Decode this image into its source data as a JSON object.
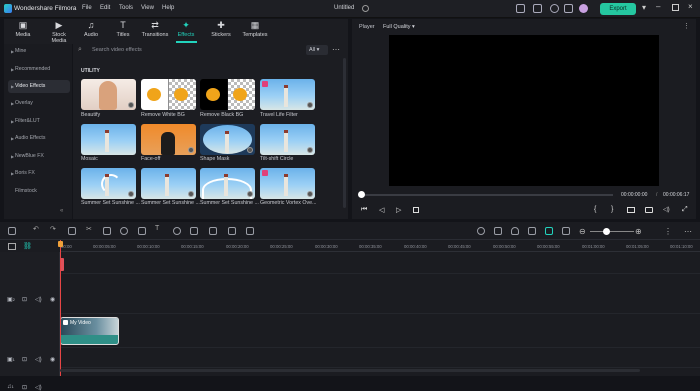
{
  "app": {
    "name": "Wondershare Filmora",
    "project": "Untitled",
    "export_label": "Export"
  },
  "menu": [
    "File",
    "Edit",
    "Tools",
    "View",
    "Help"
  ],
  "media_tabs": [
    {
      "label": "Media",
      "icon": "media-icon"
    },
    {
      "label": "Stock Media",
      "icon": "stock-media-icon"
    },
    {
      "label": "Audio",
      "icon": "audio-icon"
    },
    {
      "label": "Titles",
      "icon": "titles-icon"
    },
    {
      "label": "Transitions",
      "icon": "transitions-icon"
    },
    {
      "label": "Effects",
      "icon": "effects-icon",
      "active": true
    },
    {
      "label": "Stickers",
      "icon": "stickers-icon"
    },
    {
      "label": "Templates",
      "icon": "templates-icon"
    }
  ],
  "sidebar": [
    {
      "label": "Mine"
    },
    {
      "label": "Recommended"
    },
    {
      "label": "Video Effects",
      "active": true
    },
    {
      "label": "Overlay"
    },
    {
      "label": "Filter&LUT"
    },
    {
      "label": "Audio Effects"
    },
    {
      "label": "NewBlue FX"
    },
    {
      "label": "Boris FX"
    },
    {
      "label": "Filmstock"
    }
  ],
  "search": {
    "placeholder": "Search video effects",
    "filter": "All"
  },
  "section": "UTILITY",
  "effects": [
    {
      "label": "Beautify"
    },
    {
      "label": "Remove White BG"
    },
    {
      "label": "Remove Black BG"
    },
    {
      "label": "Travel Life Filter"
    },
    {
      "label": "Mosaic"
    },
    {
      "label": "Face-off"
    },
    {
      "label": "Shape Mask"
    },
    {
      "label": "Tilt-shift Circle"
    },
    {
      "label": "Summer Set Sunshine ..."
    },
    {
      "label": "Summer Set Sunshine ..."
    },
    {
      "label": "Summer Set Sunshine ..."
    },
    {
      "label": "Geometric Vortex Ove..."
    }
  ],
  "player": {
    "label": "Player",
    "quality": "Full Quality",
    "time_current": "00:00:00:00",
    "time_total": "00:00:06:17"
  },
  "timeline": {
    "ruler": [
      "00:00",
      "00:00:05:00",
      "00:00:10:00",
      "00:00:15:00",
      "00:00:20:00",
      "00:00:25:00",
      "00:00:30:00",
      "00:00:35:00",
      "00:00:40:00",
      "00:00:45:00",
      "00:00:50:00",
      "00:00:55:00",
      "00:01:00:00",
      "00:01:05:00",
      "00:01:10:00"
    ],
    "tracks": [
      {
        "num": "2"
      },
      {
        "num": "1"
      },
      {
        "num": "1"
      }
    ],
    "clip_label": "My Video"
  }
}
